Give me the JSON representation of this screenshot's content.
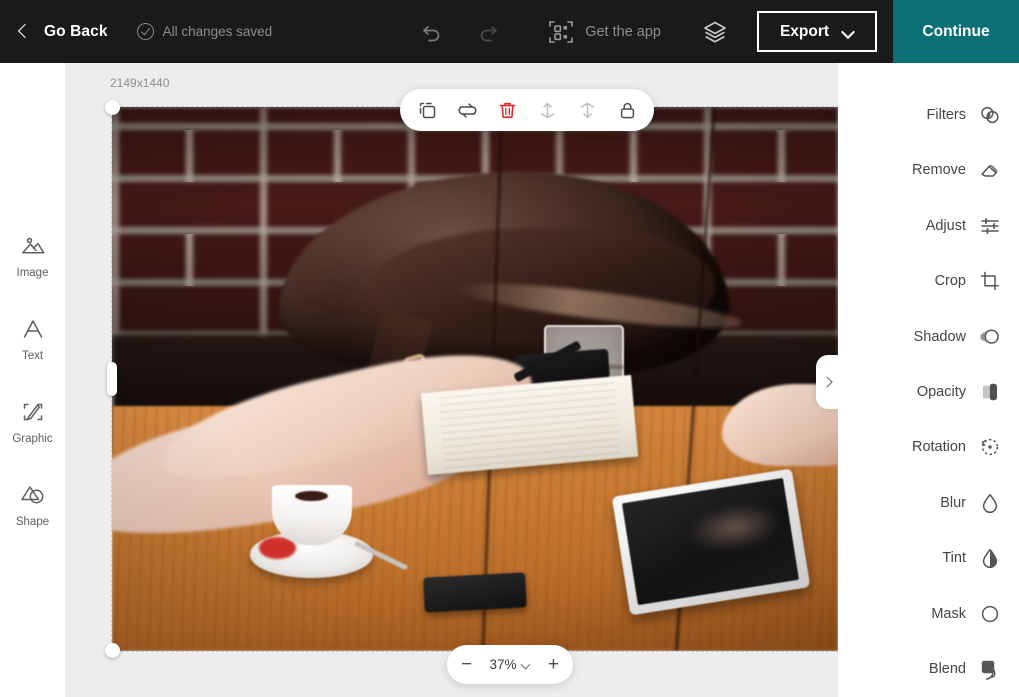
{
  "header": {
    "back_label": "Go Back",
    "back_icon": "chevron-left-icon",
    "saved_label": "All changes saved",
    "saved_icon": "check-circle-icon",
    "undo_icon": "undo-icon",
    "redo_icon": "redo-icon",
    "get_app_label": "Get the app",
    "get_app_icon": "qr-code-icon",
    "layers_icon": "layers-icon",
    "export_label": "Export",
    "export_chevron_icon": "chevron-down-icon",
    "continue_label": "Continue",
    "accent_color": "#0b7076",
    "background_color": "#1a1a1a"
  },
  "left_rail": {
    "items": [
      {
        "label": "Image",
        "icon": "image-icon"
      },
      {
        "label": "Text",
        "icon": "text-icon"
      },
      {
        "label": "Graphic",
        "icon": "graphic-pen-icon"
      },
      {
        "label": "Shape",
        "icon": "shape-icon"
      }
    ]
  },
  "canvas": {
    "dimensions_label": "2149x1440",
    "background_color": "#eceded",
    "object_toolbar": [
      {
        "name": "duplicate",
        "icon": "duplicate-icon",
        "color": "#4d4d4d"
      },
      {
        "name": "replace",
        "icon": "replace-swap-icon",
        "color": "#4d4d4d"
      },
      {
        "name": "delete",
        "icon": "trash-icon",
        "color": "#e8262d"
      },
      {
        "name": "forward",
        "icon": "bring-forward-icon",
        "color": "#b9b9b9"
      },
      {
        "name": "backward",
        "icon": "send-backward-icon",
        "color": "#b9b9b9"
      },
      {
        "name": "lock",
        "icon": "lock-icon",
        "color": "#4d4d4d"
      }
    ],
    "zoom": {
      "minus_label": "−",
      "value": "37%",
      "plus_label": "+",
      "chevron_icon": "chevron-down-icon"
    },
    "panel_tab_icon": "chevron-right-icon"
  },
  "right_panel": {
    "items": [
      {
        "label": "Filters",
        "icon": "filters-icon"
      },
      {
        "label": "Remove",
        "icon": "eraser-icon"
      },
      {
        "label": "Adjust",
        "icon": "sliders-icon"
      },
      {
        "label": "Crop",
        "icon": "crop-icon"
      },
      {
        "label": "Shadow",
        "icon": "shadow-icon"
      },
      {
        "label": "Opacity",
        "icon": "opacity-icon"
      },
      {
        "label": "Rotation",
        "icon": "rotation-icon"
      },
      {
        "label": "Blur",
        "icon": "blur-drop-icon"
      },
      {
        "label": "Tint",
        "icon": "tint-drop-icon"
      },
      {
        "label": "Mask",
        "icon": "mask-icon"
      },
      {
        "label": "Blend",
        "icon": "blend-icon"
      }
    ]
  }
}
